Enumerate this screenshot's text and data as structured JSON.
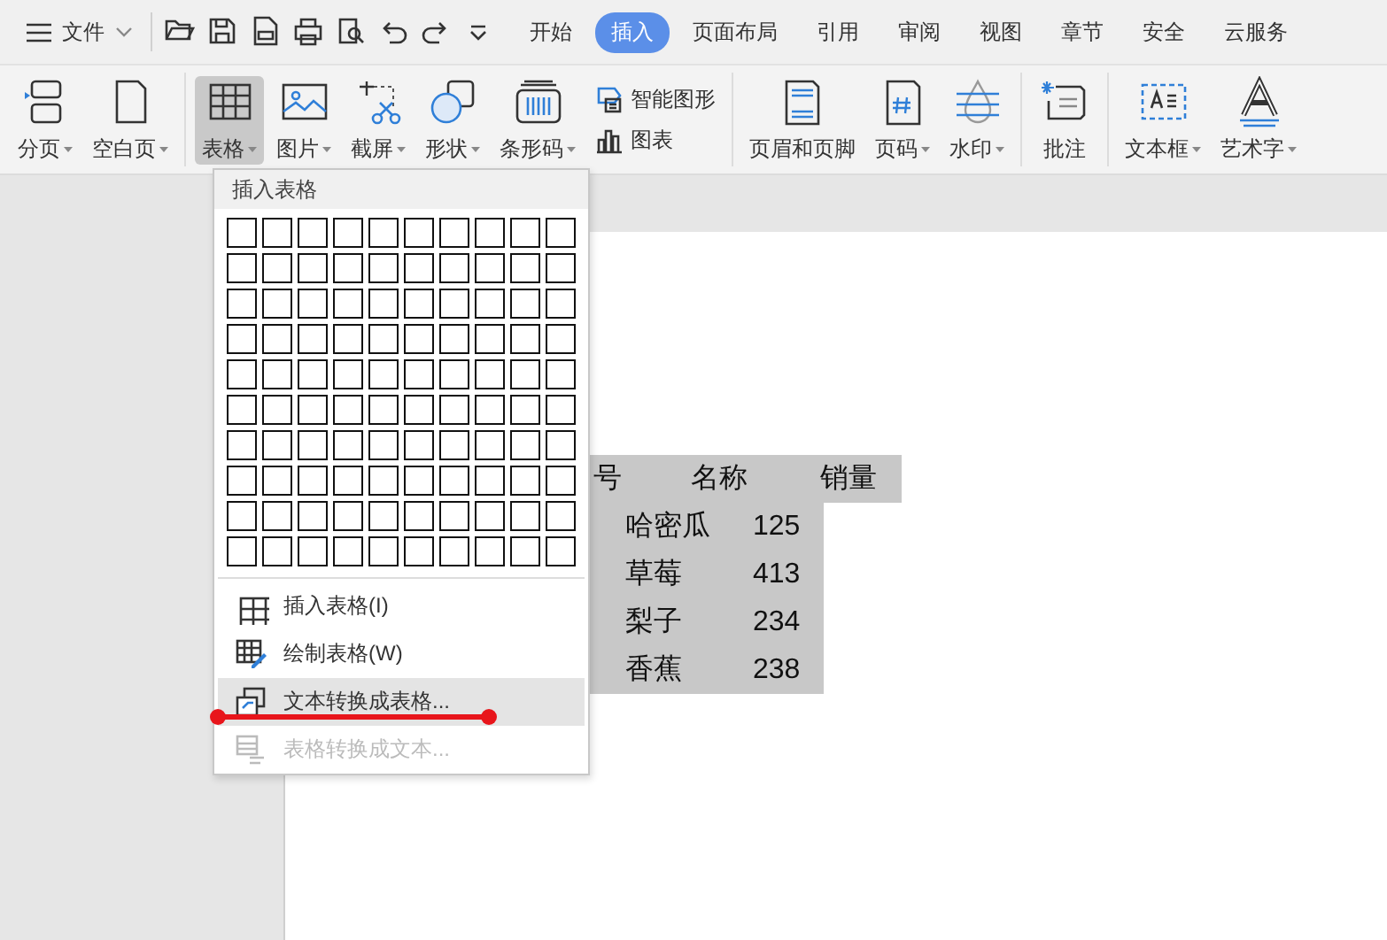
{
  "file_menu": {
    "label": "文件"
  },
  "quick_access": [
    {
      "kind": "folder"
    },
    {
      "kind": "save"
    },
    {
      "kind": "pdf"
    },
    {
      "kind": "print"
    },
    {
      "kind": "preview"
    },
    {
      "kind": "undo"
    },
    {
      "kind": "redo"
    },
    {
      "kind": "more"
    }
  ],
  "tabs": [
    {
      "label": "开始",
      "selected": false
    },
    {
      "label": "插入",
      "selected": true
    },
    {
      "label": "页面布局",
      "selected": false
    },
    {
      "label": "引用",
      "selected": false
    },
    {
      "label": "审阅",
      "selected": false
    },
    {
      "label": "视图",
      "selected": false
    },
    {
      "label": "章节",
      "selected": false
    },
    {
      "label": "安全",
      "selected": false
    },
    {
      "label": "云服务",
      "selected": false
    }
  ],
  "ribbon": {
    "groups": [
      {
        "items": [
          {
            "kind": "page-break",
            "label": "分页",
            "has_menu": true,
            "selected": false
          },
          {
            "kind": "blank-page",
            "label": "空白页",
            "has_menu": true,
            "selected": false
          }
        ]
      },
      {
        "items": [
          {
            "kind": "table",
            "label": "表格",
            "has_menu": true,
            "selected": true
          },
          {
            "kind": "picture",
            "label": "图片",
            "has_menu": true,
            "selected": false
          },
          {
            "kind": "screenshot",
            "label": "截屏",
            "has_menu": true,
            "selected": false
          },
          {
            "kind": "shapes",
            "label": "形状",
            "has_menu": true,
            "selected": false
          },
          {
            "kind": "barcode",
            "label": "条形码",
            "has_menu": true,
            "selected": false
          },
          {
            "kind": "stack",
            "items": [
              {
                "kind": "smart-graphic",
                "label": "智能图形"
              },
              {
                "kind": "chart",
                "label": "图表"
              }
            ]
          }
        ]
      },
      {
        "items": [
          {
            "kind": "header-footer",
            "label": "页眉和页脚",
            "has_menu": false,
            "selected": false
          },
          {
            "kind": "page-number",
            "label": "页码",
            "has_menu": true,
            "selected": false
          },
          {
            "kind": "watermark",
            "label": "水印",
            "has_menu": true,
            "selected": false
          }
        ]
      },
      {
        "items": [
          {
            "kind": "comment",
            "label": "批注",
            "has_menu": false,
            "selected": false
          }
        ]
      },
      {
        "items": [
          {
            "kind": "textbox",
            "label": "文本框",
            "has_menu": true,
            "selected": false
          },
          {
            "kind": "wordart",
            "label": "艺术字",
            "has_menu": true,
            "selected": false
          }
        ]
      }
    ]
  },
  "document": {
    "lines": [
      {
        "kind": "header",
        "cells": [
          "号",
          "名称",
          "销量"
        ]
      },
      {
        "kind": "row",
        "cells": [
          "哈密瓜",
          "125"
        ]
      },
      {
        "kind": "row",
        "cells": [
          "草莓",
          "413"
        ]
      },
      {
        "kind": "row",
        "cells": [
          "梨子",
          "234"
        ]
      },
      {
        "kind": "row",
        "cells": [
          "香蕉",
          "238"
        ]
      }
    ]
  },
  "table_menu": {
    "title": "插入表格",
    "items": [
      {
        "kind": "table",
        "label": "插入表格(I)",
        "highlighted": false,
        "disabled": false
      },
      {
        "kind": "draw-table",
        "label": "绘制表格(W)",
        "highlighted": false,
        "disabled": false
      },
      {
        "kind": "convert",
        "label": "文本转换成表格...",
        "highlighted": true,
        "disabled": false
      },
      {
        "kind": "convert-back",
        "label": "表格转换成文本...",
        "highlighted": false,
        "disabled": true
      }
    ]
  },
  "annotations": [
    {
      "kind": "underline"
    }
  ]
}
